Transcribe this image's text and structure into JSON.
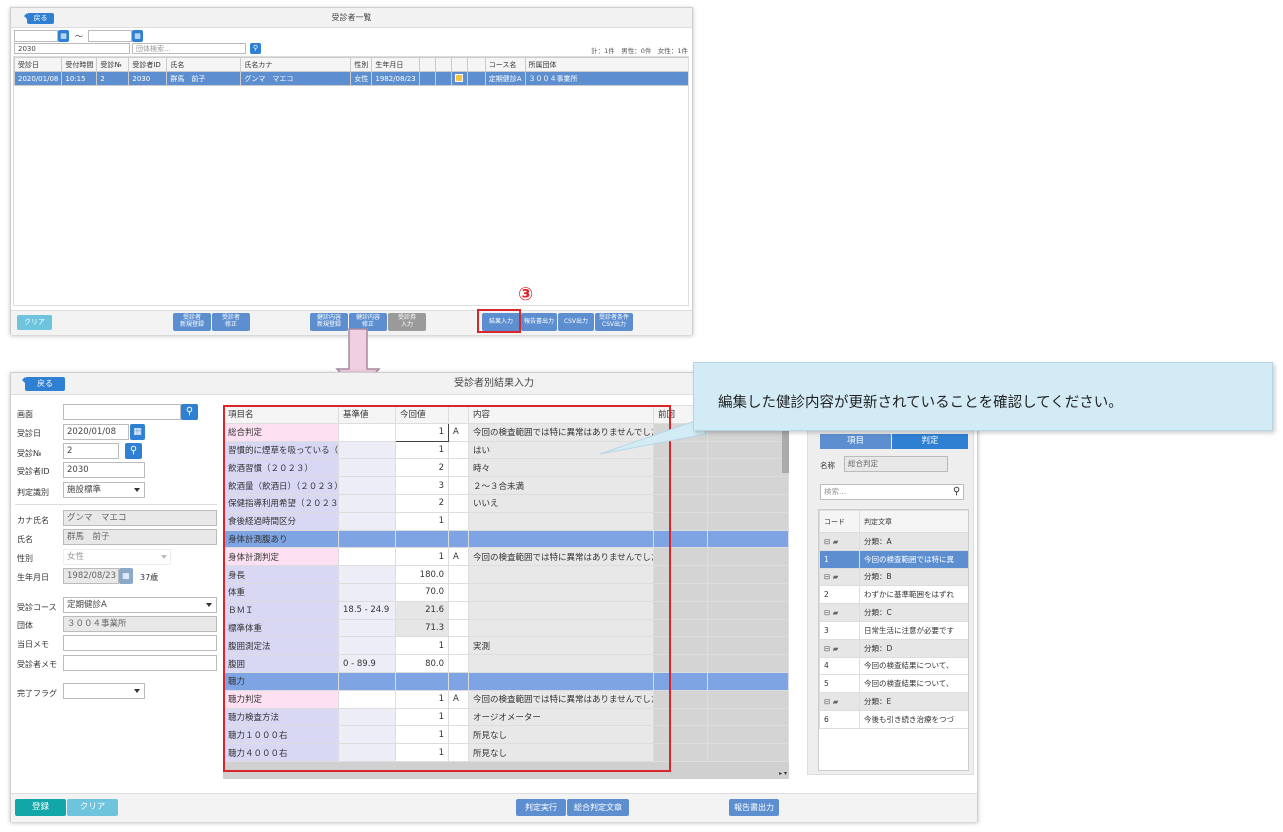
{
  "top": {
    "title": "受診者一覧",
    "back": "戻る",
    "date_sep": "～",
    "id_value": "2030",
    "group_placeholder": "団体検索...",
    "counts": "計：1件　男性：0件　女性：1件",
    "headers": [
      "受診日",
      "受付時間",
      "受診№",
      "受診者ID",
      "氏名",
      "氏名カナ",
      "性別",
      "生年月日",
      "",
      "",
      "",
      "",
      "コース名",
      "所属団体"
    ],
    "row": [
      "2020/01/08",
      "10:15",
      "2",
      "2030",
      "群馬　前子",
      "グンマ　マエコ",
      "女性",
      "1982/08/23",
      "",
      "",
      "",
      "",
      "定期健診A",
      "３００４事業所"
    ],
    "buttons": {
      "clear": "クリア",
      "new_reg": [
        "受診者",
        "新規登録"
      ],
      "edit": [
        "受診者",
        "修正"
      ],
      "kenshin_new": [
        "健診内容",
        "新規登録"
      ],
      "kenshin": [
        "健診内容",
        "修正"
      ],
      "uke": [
        "受診券",
        "入力"
      ],
      "result": "結果入力",
      "report": "報告書出力",
      "csv": "CSV出力",
      "csv_cond": [
        "受診者条件",
        "CSV出力"
      ]
    },
    "step_marker": "③"
  },
  "tooltip": "編集した健診内容が更新されていることを確認してください。",
  "bottom": {
    "title": "受診者別結果入力",
    "back": "戻る",
    "form": {
      "labels": [
        "画面",
        "受診日",
        "受診№",
        "受診者ID",
        "判定識別",
        "カナ氏名",
        "氏名",
        "性別",
        "生年月日",
        "受診コース",
        "団体",
        "当日メモ",
        "受診者メモ",
        "完了フラグ"
      ],
      "date": "2020/01/08",
      "no": "2",
      "id": "2030",
      "judge_type": "施設標準",
      "kana": "グンマ　マエコ",
      "name": "群馬　前子",
      "sex": "女性",
      "birth": "1982/08/23",
      "age": "37歳",
      "course": "定期健診A",
      "group": "３００４事業所"
    },
    "table_headers": [
      "項目名",
      "基準値",
      "今回値",
      "",
      "内容",
      "前回"
    ],
    "rows": [
      {
        "name": "総合判定",
        "std": "",
        "val": "1",
        "flag": "A",
        "content": "今回の検査範囲では特に異常はありませんでした。",
        "type": "judge"
      },
      {
        "name": "習慣的に煙草を吸っている（2",
        "std": "",
        "val": "1",
        "flag": "",
        "content": "はい",
        "type": "item"
      },
      {
        "name": "飲酒習慣（２０２３）",
        "std": "",
        "val": "2",
        "flag": "",
        "content": "時々",
        "type": "item"
      },
      {
        "name": "飲酒量（飲酒日）（２０２３）",
        "std": "",
        "val": "3",
        "flag": "",
        "content": "２～３合未満",
        "type": "item"
      },
      {
        "name": "保健指導利用希望（２０２３）",
        "std": "",
        "val": "2",
        "flag": "",
        "content": "いいえ",
        "type": "item"
      },
      {
        "name": "食後経過時間区分",
        "std": "",
        "val": "1",
        "flag": "",
        "content": "",
        "type": "item"
      },
      {
        "name": "身体計測腹あり",
        "std": "",
        "val": "",
        "flag": "",
        "content": "",
        "type": "section"
      },
      {
        "name": "身体計測判定",
        "std": "",
        "val": "1",
        "flag": "A",
        "content": "今回の検査範囲では特に異常はありませんでした。",
        "type": "judge"
      },
      {
        "name": "身長",
        "std": "",
        "val": "180.0",
        "flag": "",
        "content": "",
        "type": "item"
      },
      {
        "name": "体重",
        "std": "",
        "val": "70.0",
        "flag": "",
        "content": "",
        "type": "item"
      },
      {
        "name": "ＢＭＩ",
        "std": "18.5 - 24.9",
        "val": "21.6",
        "flag": "",
        "content": "",
        "type": "calc"
      },
      {
        "name": "標準体重",
        "std": "",
        "val": "71.3",
        "flag": "",
        "content": "",
        "type": "calc"
      },
      {
        "name": "腹囲測定法",
        "std": "",
        "val": "1",
        "flag": "",
        "content": "実測",
        "type": "item"
      },
      {
        "name": "腹囲",
        "std": "0 - 89.9",
        "val": "80.0",
        "flag": "",
        "content": "",
        "type": "item"
      },
      {
        "name": "聴力",
        "std": "",
        "val": "",
        "flag": "",
        "content": "",
        "type": "section"
      },
      {
        "name": "聴力判定",
        "std": "",
        "val": "1",
        "flag": "A",
        "content": "今回の検査範囲では特に異常はありませんでした。",
        "type": "judge"
      },
      {
        "name": "聴力検査方法",
        "std": "",
        "val": "1",
        "flag": "",
        "content": "オージオメーター",
        "type": "item"
      },
      {
        "name": "聴力１０００右",
        "std": "",
        "val": "1",
        "flag": "",
        "content": "所見なし",
        "type": "item"
      },
      {
        "name": "聴力４０００右",
        "std": "",
        "val": "1",
        "flag": "",
        "content": "所見なし",
        "type": "item"
      }
    ],
    "right": {
      "tabs": [
        "項目",
        "判定"
      ],
      "name_label": "名称",
      "name_value": "総合判定",
      "search_placeholder": "検索...",
      "headers": [
        "コード",
        "判定文章"
      ],
      "rows": [
        {
          "type": "group",
          "code": "",
          "text": "分類：A"
        },
        {
          "type": "sel",
          "code": "1",
          "text": "今回の検査範囲では特に異"
        },
        {
          "type": "group",
          "code": "",
          "text": "分類：B"
        },
        {
          "type": "item",
          "code": "2",
          "text": "わずかに基準範囲をはずれ"
        },
        {
          "type": "group",
          "code": "",
          "text": "分類：C"
        },
        {
          "type": "item",
          "code": "3",
          "text": "日常生活に注意が必要です"
        },
        {
          "type": "group",
          "code": "",
          "text": "分類：D"
        },
        {
          "type": "item",
          "code": "4",
          "text": "今回の検査結果について、"
        },
        {
          "type": "item",
          "code": "5",
          "text": "今回の検査結果について、"
        },
        {
          "type": "group",
          "code": "",
          "text": "分類：E"
        },
        {
          "type": "item",
          "code": "6",
          "text": "今後も引き続き治療をつづ"
        }
      ]
    },
    "buttons": {
      "register": "登録",
      "clear": "クリア",
      "judge_run": "判定実行",
      "total_text": "総合判定文章",
      "report": "報告書出力"
    }
  }
}
